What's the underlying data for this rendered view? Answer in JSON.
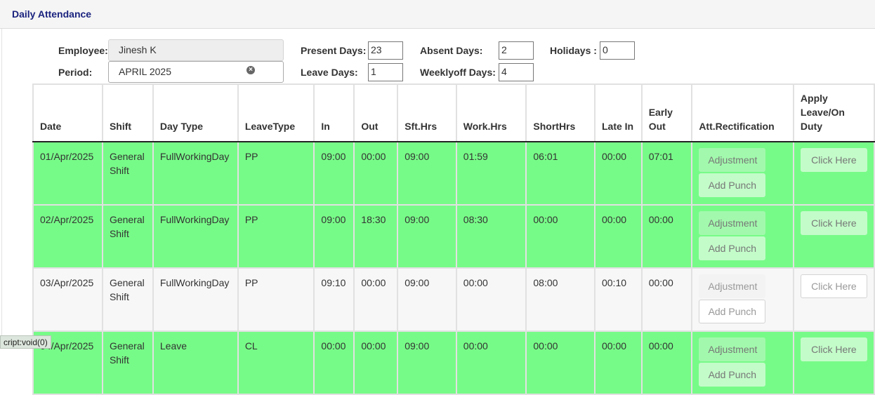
{
  "header": {
    "title": "Daily Attendance"
  },
  "form": {
    "employee_label": "Employee:",
    "employee_value": "Jinesh K",
    "period_label": "Period:",
    "period_value": "APRIL 2025",
    "present_label": "Present Days:",
    "present_value": "23",
    "absent_label": "Absent Days:",
    "absent_value": "2",
    "holidays_label": "Holidays :",
    "holidays_value": "0",
    "leave_label": "Leave Days:",
    "leave_value": "1",
    "weeklyoff_label": "Weeklyoff Days:",
    "weeklyoff_value": "4"
  },
  "table": {
    "headers": [
      "Date",
      "Shift",
      "Day Type",
      "LeaveType",
      "In",
      "Out",
      "Sft.Hrs",
      "Work.Hrs",
      "ShortHrs",
      "Late In",
      "Early Out",
      "Att.Rectification",
      "Apply Leave/On Duty"
    ],
    "adjustment_label": "Adjustment",
    "add_punch_label": "Add Punch",
    "click_here_label": "Click Here",
    "rows": [
      {
        "date": "01/Apr/2025",
        "shift": "General Shift",
        "day_type": "FullWorkingDay",
        "leave_type": "PP",
        "in": "09:00",
        "out": "00:00",
        "sft_hrs": "09:00",
        "work_hrs": "01:59",
        "short_hrs": "06:01",
        "late_in": "00:00",
        "early_out": "07:01",
        "status": "green"
      },
      {
        "date": "02/Apr/2025",
        "shift": "General Shift",
        "day_type": "FullWorkingDay",
        "leave_type": "PP",
        "in": "09:00",
        "out": "18:30",
        "sft_hrs": "09:00",
        "work_hrs": "08:30",
        "short_hrs": "00:00",
        "late_in": "00:00",
        "early_out": "00:00",
        "status": "green"
      },
      {
        "date": "03/Apr/2025",
        "shift": "General Shift",
        "day_type": "FullWorkingDay",
        "leave_type": "PP",
        "in": "09:10",
        "out": "00:00",
        "sft_hrs": "09:00",
        "work_hrs": "00:00",
        "short_hrs": "08:00",
        "late_in": "00:10",
        "early_out": "00:00",
        "status": "grey"
      },
      {
        "date": "04/Apr/2025",
        "shift": "General Shift",
        "day_type": "Leave",
        "leave_type": "CL",
        "in": "00:00",
        "out": "00:00",
        "sft_hrs": "09:00",
        "work_hrs": "00:00",
        "short_hrs": "00:00",
        "late_in": "00:00",
        "early_out": "00:00",
        "status": "green"
      }
    ]
  },
  "statusbar": {
    "text": "cript:void(0)"
  },
  "colors": {
    "present_row": "#77fb88",
    "absent_row": "#f7f7f7",
    "title": "#1a237e"
  }
}
